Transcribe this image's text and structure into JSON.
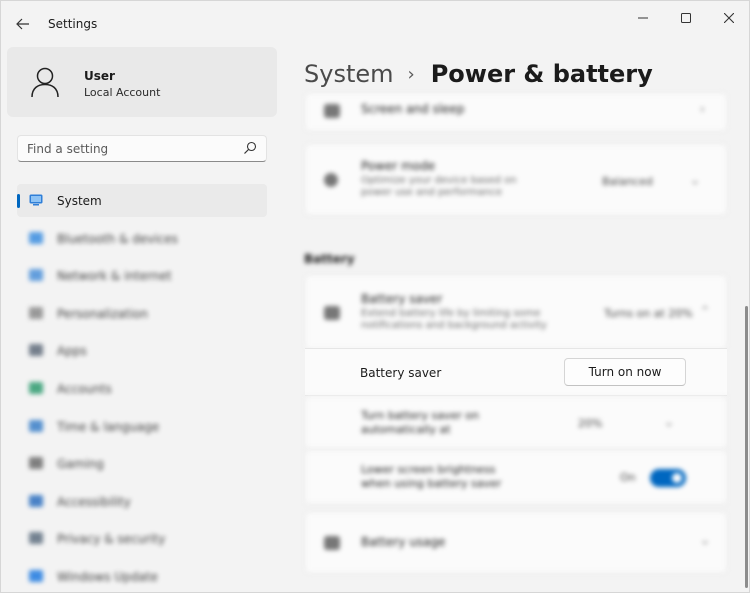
{
  "window": {
    "title": "Settings"
  },
  "user": {
    "name": "User",
    "account_type": "Local Account"
  },
  "search": {
    "placeholder": "Find a setting"
  },
  "nav": {
    "items": [
      {
        "label": "System",
        "icon": "monitor-icon",
        "color": "#2f7fd8"
      },
      {
        "label": "Bluetooth & devices",
        "icon": "bluetooth-icon",
        "color": "#3a8de0"
      },
      {
        "label": "Network & internet",
        "icon": "wifi-icon",
        "color": "#4a90d9"
      },
      {
        "label": "Personalization",
        "icon": "brush-icon",
        "color": "#8a8a8a"
      },
      {
        "label": "Apps",
        "icon": "apps-icon",
        "color": "#5f6b7a"
      },
      {
        "label": "Accounts",
        "icon": "person-icon",
        "color": "#2e9b6f"
      },
      {
        "label": "Time & language",
        "icon": "clock-globe-icon",
        "color": "#3a7fc8"
      },
      {
        "label": "Gaming",
        "icon": "gamepad-icon",
        "color": "#6b6b6b"
      },
      {
        "label": "Accessibility",
        "icon": "accessibility-icon",
        "color": "#2c6fbf"
      },
      {
        "label": "Privacy & security",
        "icon": "shield-icon",
        "color": "#5e6f80"
      },
      {
        "label": "Windows Update",
        "icon": "update-icon",
        "color": "#1f7ae0"
      }
    ]
  },
  "breadcrumb": {
    "parent": "System",
    "separator": "›",
    "current": "Power & battery"
  },
  "main": {
    "screen_sleep": {
      "title": "Screen and sleep"
    },
    "power_mode": {
      "title": "Power mode",
      "description": "Optimize your device based on power use and performance",
      "value": "Balanced"
    },
    "section_label": "Battery",
    "battery_saver_card": {
      "title": "Battery saver",
      "description": "Extend battery life by limiting some notifications and background activity",
      "value": "Turns on at 20%"
    },
    "battery_saver_row": {
      "label": "Battery saver",
      "button": "Turn on now"
    },
    "auto_on_row": {
      "label": "Turn battery saver on automatically at",
      "value": "20%"
    },
    "brightness_row": {
      "label": "Lower screen brightness when using battery saver",
      "state": "On"
    },
    "battery_usage": {
      "title": "Battery usage"
    }
  },
  "colors": {
    "accent": "#0067c0"
  }
}
